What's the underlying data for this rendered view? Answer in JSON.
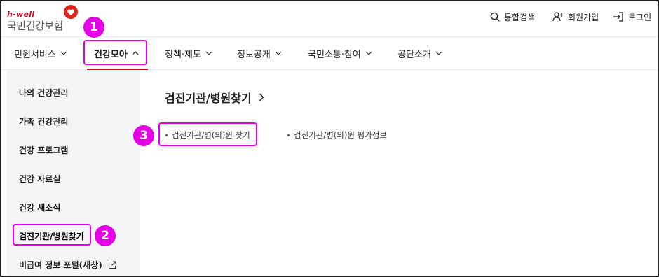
{
  "brand": {
    "tagline": "h-well",
    "name": "국민건강보험",
    "heart_color": "#e2231a"
  },
  "utility": {
    "search_label": "통합검색",
    "join_label": "회원가입",
    "login_label": "로그인"
  },
  "nav": {
    "items": [
      {
        "label": "민원서비스"
      },
      {
        "label": "건강모아"
      },
      {
        "label": "정책·제도"
      },
      {
        "label": "정보공개"
      },
      {
        "label": "국민소통·참여"
      },
      {
        "label": "공단소개"
      }
    ],
    "active_index": 1,
    "accent_color": "#d0021b"
  },
  "sidebar": {
    "items": [
      {
        "label": "나의 건강관리"
      },
      {
        "label": "가족 건강관리"
      },
      {
        "label": "건강 프로그램"
      },
      {
        "label": "건강 자료실"
      },
      {
        "label": "건강 새소식"
      },
      {
        "label": "검진기관/병원찾기"
      },
      {
        "label": "비급여 정보 포털(새창)"
      }
    ],
    "active_index": 5
  },
  "content": {
    "title": "검진기관/병원찾기",
    "links": [
      {
        "label": "검진기관/병(의)원 찾기"
      },
      {
        "label": "검진기관/병(의)원 평가정보"
      }
    ]
  },
  "annotations": {
    "color": "#e600e6",
    "badges": [
      "1",
      "2",
      "3"
    ]
  }
}
